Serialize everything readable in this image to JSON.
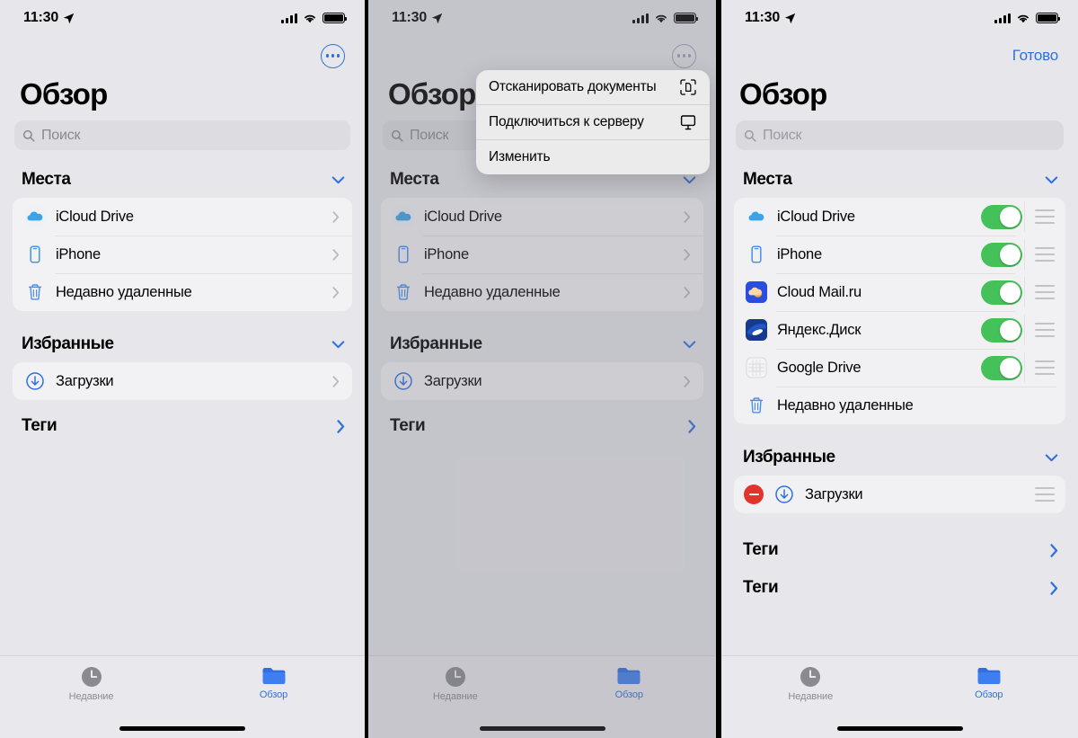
{
  "status_bar": {
    "time": "11:30",
    "location_icon": "location-arrow-icon",
    "cellular_icon": "signal-bars-icon",
    "wifi_icon": "wifi-icon",
    "battery_icon": "battery-full-icon"
  },
  "panel1": {
    "more_button_label": "more-options",
    "title": "Обзор",
    "search": {
      "placeholder": "Поиск",
      "icon": "search-icon"
    },
    "sections": [
      {
        "header": "Места",
        "collapse_icon": "chevron-down-icon",
        "rows": [
          {
            "label": "iCloud Drive",
            "icon": "icloud-drive-icon",
            "chevron": "chevron-right-icon"
          },
          {
            "label": "iPhone",
            "icon": "iphone-icon",
            "chevron": "chevron-right-icon"
          },
          {
            "label": "Недавно удаленные",
            "icon": "trash-icon",
            "chevron": "chevron-right-icon"
          }
        ]
      },
      {
        "header": "Избранные",
        "collapse_icon": "chevron-down-icon",
        "rows": [
          {
            "label": "Загрузки",
            "icon": "downloads-icon",
            "chevron": "chevron-right-icon"
          }
        ]
      }
    ],
    "tags_row": {
      "label": "Теги",
      "chevron": "chevron-right-icon"
    }
  },
  "panel2": {
    "more_button_label": "more-options",
    "title": "Обзор",
    "search": {
      "placeholder": "Поиск",
      "icon": "search-icon"
    },
    "context_menu": {
      "items": [
        {
          "label": "Отсканировать документы",
          "icon": "document-scan-icon"
        },
        {
          "label": "Подключиться к серверу",
          "icon": "monitor-icon"
        },
        {
          "label": "Изменить",
          "icon": ""
        }
      ]
    },
    "sections": [
      {
        "header": "Места",
        "collapse_icon": "chevron-down-icon",
        "rows": [
          {
            "label": "iCloud Drive",
            "icon": "icloud-drive-icon",
            "chevron": "chevron-right-icon"
          },
          {
            "label": "iPhone",
            "icon": "iphone-icon",
            "chevron": "chevron-right-icon"
          },
          {
            "label": "Недавно удаленные",
            "icon": "trash-icon",
            "chevron": "chevron-right-icon"
          }
        ]
      },
      {
        "header": "Избранные",
        "collapse_icon": "chevron-down-icon",
        "rows": [
          {
            "label": "Загрузки",
            "icon": "downloads-icon",
            "chevron": "chevron-right-icon"
          }
        ]
      }
    ],
    "tags_row": {
      "label": "Теги",
      "chevron": "chevron-right-icon"
    }
  },
  "panel3": {
    "done_button": "Готово",
    "title": "Обзор",
    "search": {
      "placeholder": "Поиск",
      "icon": "search-icon"
    },
    "sections": [
      {
        "header": "Места",
        "collapse_icon": "chevron-down-icon",
        "rows": [
          {
            "label": "iCloud Drive",
            "icon": "icloud-drive-icon",
            "toggle": "on",
            "grip": "reorder-handle-icon"
          },
          {
            "label": "iPhone",
            "icon": "iphone-icon",
            "toggle": "on",
            "grip": "reorder-handle-icon"
          },
          {
            "label": "Cloud Mail.ru",
            "icon": "cloud-mailru-icon",
            "toggle": "on",
            "grip": "reorder-handle-icon"
          },
          {
            "label": "Яндекс.Диск",
            "icon": "yandex-disk-icon",
            "toggle": "on",
            "grip": "reorder-handle-icon"
          },
          {
            "label": "Google Drive",
            "icon": "google-drive-icon",
            "toggle": "on",
            "grip": "reorder-handle-icon"
          },
          {
            "label": "Недавно удаленные",
            "icon": "trash-icon",
            "toggle": "none",
            "grip": ""
          }
        ]
      },
      {
        "header": "Избранные",
        "collapse_icon": "chevron-down-icon",
        "rows": [
          {
            "label": "Загрузки",
            "icon": "downloads-icon",
            "remove": "remove-button",
            "grip": "reorder-handle-icon"
          }
        ]
      }
    ],
    "tags_rows": [
      {
        "label": "Теги",
        "chevron": "chevron-right-icon"
      },
      {
        "label": "Теги",
        "chevron": "chevron-right-icon"
      }
    ]
  },
  "tabbar": {
    "tabs": [
      {
        "label": "Недавние",
        "icon": "clock-icon",
        "active": false
      },
      {
        "label": "Обзор",
        "icon": "folder-icon",
        "active": true
      }
    ]
  },
  "colors": {
    "accent_blue": "#2f6fe0",
    "toggle_green": "#45c159",
    "remove_red": "#e0352b",
    "bg": "#e6e6eb",
    "card": "#f2f2f5"
  }
}
